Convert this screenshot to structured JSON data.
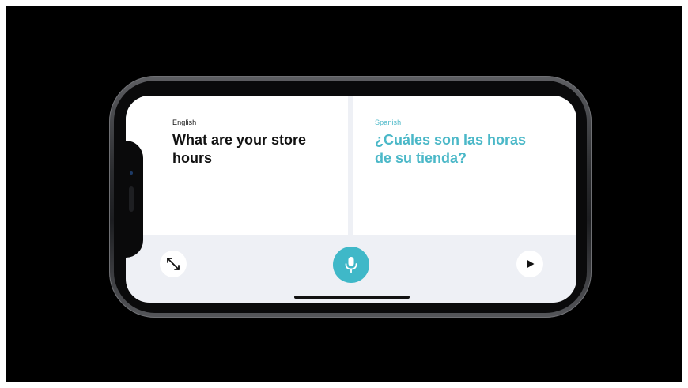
{
  "left_panel": {
    "language": "English",
    "phrase": "What are your store hours"
  },
  "right_panel": {
    "language": "Spanish",
    "phrase": "¿Cuáles son las horas de su tienda?"
  },
  "controls": {
    "left_icon": "expand-icon",
    "center_icon": "microphone-icon",
    "right_icon": "play-icon"
  },
  "colors": {
    "accent": "#3fb8c8",
    "translated_text": "#4bb8c8",
    "background": "#000000",
    "screen": "#eef0f5"
  }
}
